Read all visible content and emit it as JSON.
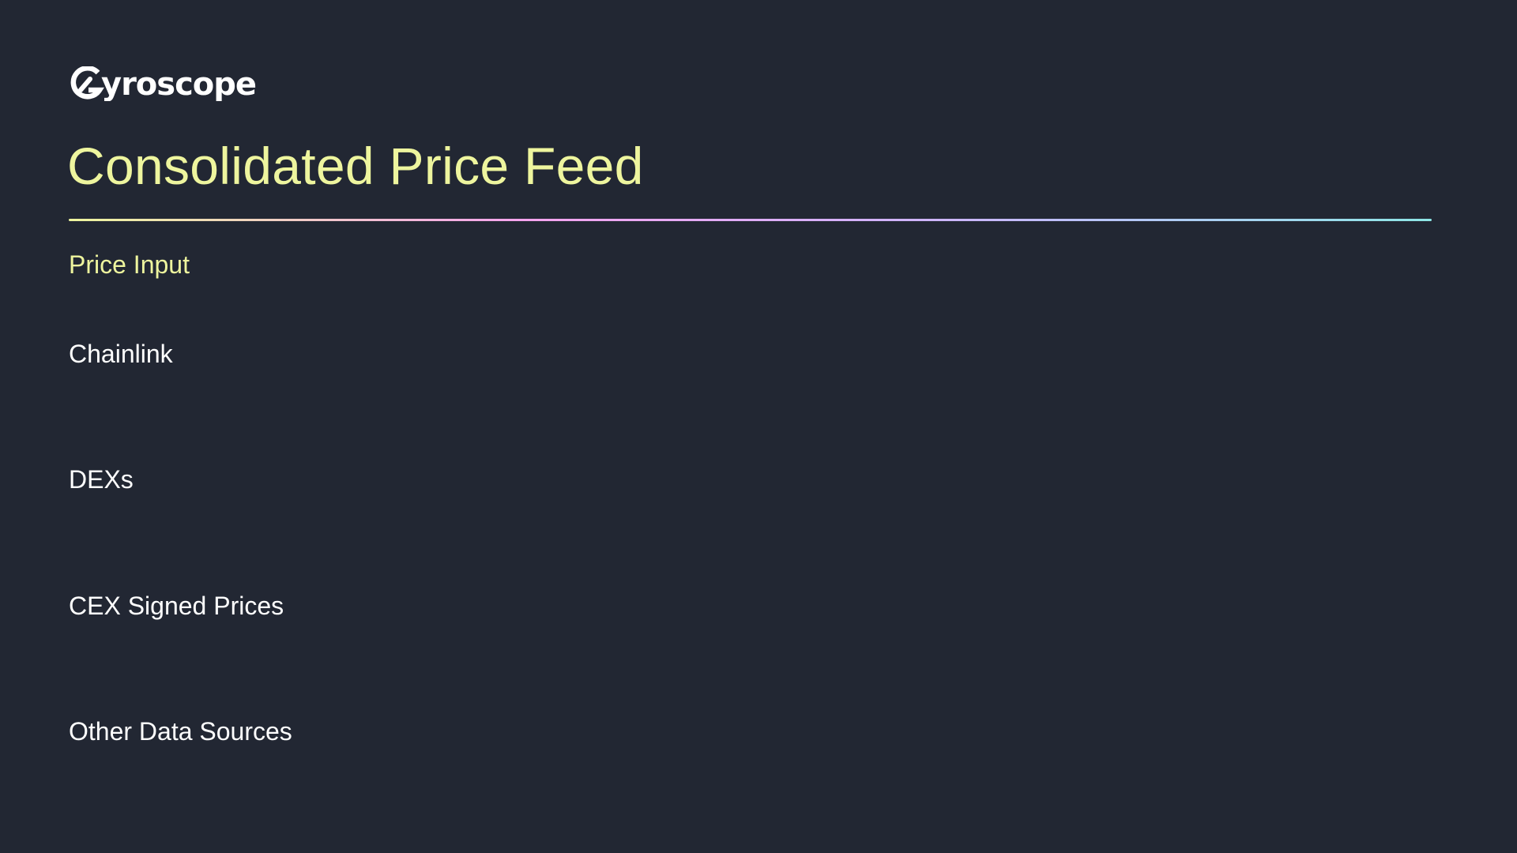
{
  "brand": {
    "logo_text": "Gyroscope"
  },
  "slide": {
    "title": "Consolidated Price Feed",
    "section_label": "Price Input",
    "sources": [
      "Chainlink",
      "DEXs",
      "CEX Signed Prices",
      "Other Data Sources"
    ]
  },
  "colors": {
    "background": "#222733",
    "accent": "#EEF59E",
    "text": "#FFFFFF",
    "divider_gradient": [
      "#EEF59E",
      "#F5A3EE",
      "#C9B7FF",
      "#8EE6E6"
    ]
  }
}
